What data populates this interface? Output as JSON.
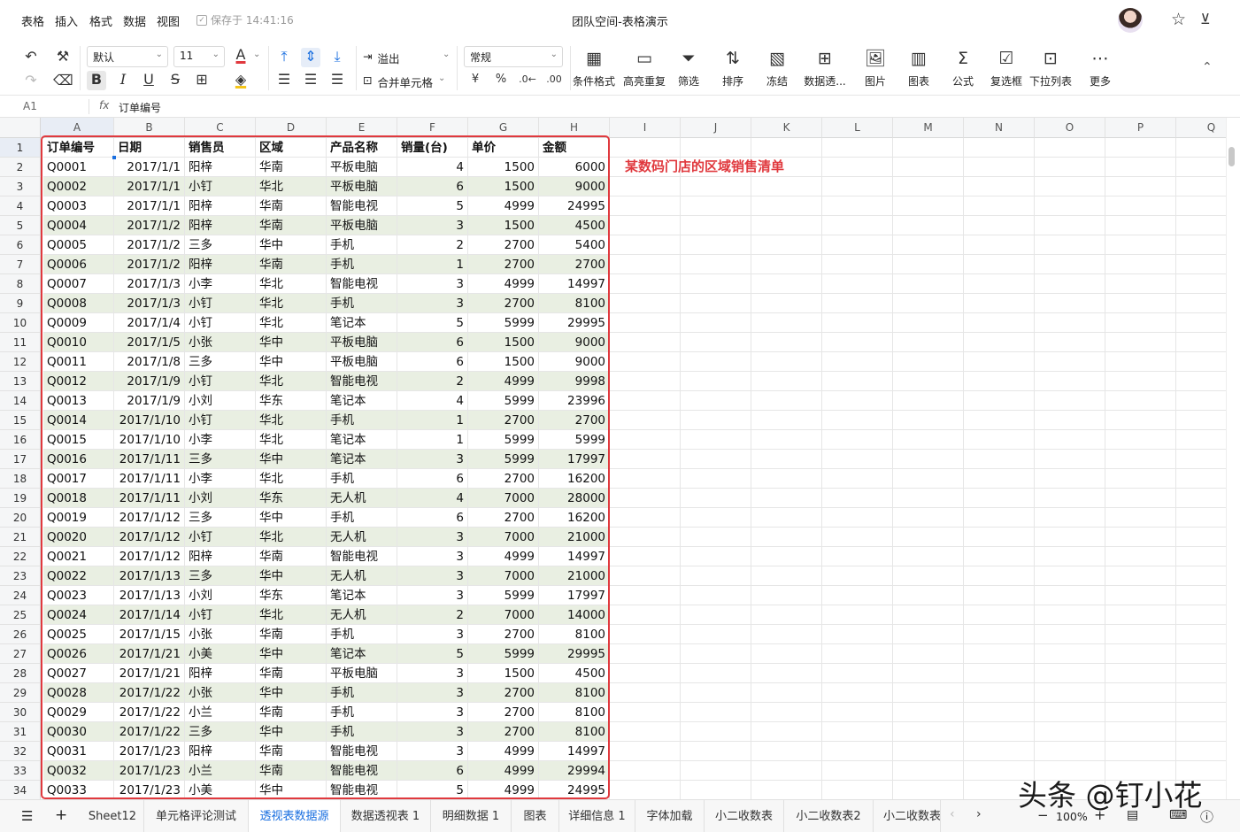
{
  "menu": {
    "items": [
      "表格",
      "插入",
      "格式",
      "数据",
      "视图"
    ],
    "save_status": "保存于 14:41:16",
    "doc_title": "团队空间-表格演示"
  },
  "toolbar": {
    "font_name": "默认",
    "font_size": "11",
    "overflow": "溢出",
    "merge": "合并单元格",
    "number_format": "常规",
    "currency": "¥",
    "percent": "%",
    "big_buttons": [
      {
        "label": "条件格式",
        "icon": "conditional-format-icon",
        "glyph": "▦"
      },
      {
        "label": "高亮重复",
        "icon": "highlight-duplicate-icon",
        "glyph": "▭"
      },
      {
        "label": "筛选",
        "icon": "filter-icon",
        "glyph": "⏷"
      },
      {
        "label": "排序",
        "icon": "sort-icon",
        "glyph": "⇅"
      },
      {
        "label": "冻结",
        "icon": "freeze-icon",
        "glyph": "▧"
      },
      {
        "label": "数据透...",
        "icon": "pivot-icon",
        "glyph": "⊞"
      },
      {
        "label": "图片",
        "icon": "image-icon",
        "glyph": "🖼"
      },
      {
        "label": "图表",
        "icon": "chart-icon",
        "glyph": "▥"
      },
      {
        "label": "公式",
        "icon": "formula-icon",
        "glyph": "Σ"
      },
      {
        "label": "复选框",
        "icon": "checkbox-icon",
        "glyph": "☑"
      },
      {
        "label": "下拉列表",
        "icon": "dropdown-list-icon",
        "glyph": "⊡"
      },
      {
        "label": "更多",
        "icon": "more-icon",
        "glyph": "⋯"
      }
    ]
  },
  "formula_bar": {
    "cell_ref": "A1",
    "fx": "fx",
    "content": "订单编号"
  },
  "sheet": {
    "columns": [
      "A",
      "B",
      "C",
      "D",
      "E",
      "F",
      "G",
      "H",
      "I",
      "J",
      "K",
      "L",
      "M",
      "N",
      "O",
      "P",
      "Q"
    ],
    "headers": [
      "订单编号",
      "日期",
      "销售员",
      "区域",
      "产品名称",
      "销量(台)",
      "单价",
      "金额"
    ],
    "rows": [
      [
        "Q0001",
        "2017/1/1",
        "阳梓",
        "华南",
        "平板电脑",
        "4",
        "1500",
        "6000"
      ],
      [
        "Q0002",
        "2017/1/1",
        "小钉",
        "华北",
        "平板电脑",
        "6",
        "1500",
        "9000"
      ],
      [
        "Q0003",
        "2017/1/1",
        "阳梓",
        "华南",
        "智能电视",
        "5",
        "4999",
        "24995"
      ],
      [
        "Q0004",
        "2017/1/2",
        "阳梓",
        "华南",
        "平板电脑",
        "3",
        "1500",
        "4500"
      ],
      [
        "Q0005",
        "2017/1/2",
        "三多",
        "华中",
        "手机",
        "2",
        "2700",
        "5400"
      ],
      [
        "Q0006",
        "2017/1/2",
        "阳梓",
        "华南",
        "手机",
        "1",
        "2700",
        "2700"
      ],
      [
        "Q0007",
        "2017/1/3",
        "小李",
        "华北",
        "智能电视",
        "3",
        "4999",
        "14997"
      ],
      [
        "Q0008",
        "2017/1/3",
        "小钉",
        "华北",
        "手机",
        "3",
        "2700",
        "8100"
      ],
      [
        "Q0009",
        "2017/1/4",
        "小钉",
        "华北",
        "笔记本",
        "5",
        "5999",
        "29995"
      ],
      [
        "Q0010",
        "2017/1/5",
        "小张",
        "华中",
        "平板电脑",
        "6",
        "1500",
        "9000"
      ],
      [
        "Q0011",
        "2017/1/8",
        "三多",
        "华中",
        "平板电脑",
        "6",
        "1500",
        "9000"
      ],
      [
        "Q0012",
        "2017/1/9",
        "小钉",
        "华北",
        "智能电视",
        "2",
        "4999",
        "9998"
      ],
      [
        "Q0013",
        "2017/1/9",
        "小刘",
        "华东",
        "笔记本",
        "4",
        "5999",
        "23996"
      ],
      [
        "Q0014",
        "2017/1/10",
        "小钉",
        "华北",
        "手机",
        "1",
        "2700",
        "2700"
      ],
      [
        "Q0015",
        "2017/1/10",
        "小李",
        "华北",
        "笔记本",
        "1",
        "5999",
        "5999"
      ],
      [
        "Q0016",
        "2017/1/11",
        "三多",
        "华中",
        "笔记本",
        "3",
        "5999",
        "17997"
      ],
      [
        "Q0017",
        "2017/1/11",
        "小李",
        "华北",
        "手机",
        "6",
        "2700",
        "16200"
      ],
      [
        "Q0018",
        "2017/1/11",
        "小刘",
        "华东",
        "无人机",
        "4",
        "7000",
        "28000"
      ],
      [
        "Q0019",
        "2017/1/12",
        "三多",
        "华中",
        "手机",
        "6",
        "2700",
        "16200"
      ],
      [
        "Q0020",
        "2017/1/12",
        "小钉",
        "华北",
        "无人机",
        "3",
        "7000",
        "21000"
      ],
      [
        "Q0021",
        "2017/1/12",
        "阳梓",
        "华南",
        "智能电视",
        "3",
        "4999",
        "14997"
      ],
      [
        "Q0022",
        "2017/1/13",
        "三多",
        "华中",
        "无人机",
        "3",
        "7000",
        "21000"
      ],
      [
        "Q0023",
        "2017/1/13",
        "小刘",
        "华东",
        "笔记本",
        "3",
        "5999",
        "17997"
      ],
      [
        "Q0024",
        "2017/1/14",
        "小钉",
        "华北",
        "无人机",
        "2",
        "7000",
        "14000"
      ],
      [
        "Q0025",
        "2017/1/15",
        "小张",
        "华南",
        "手机",
        "3",
        "2700",
        "8100"
      ],
      [
        "Q0026",
        "2017/1/21",
        "小美",
        "华中",
        "笔记本",
        "5",
        "5999",
        "29995"
      ],
      [
        "Q0027",
        "2017/1/21",
        "阳梓",
        "华南",
        "平板电脑",
        "3",
        "1500",
        "4500"
      ],
      [
        "Q0028",
        "2017/1/22",
        "小张",
        "华中",
        "手机",
        "3",
        "2700",
        "8100"
      ],
      [
        "Q0029",
        "2017/1/22",
        "小兰",
        "华南",
        "手机",
        "3",
        "2700",
        "8100"
      ],
      [
        "Q0030",
        "2017/1/22",
        "三多",
        "华中",
        "手机",
        "3",
        "2700",
        "8100"
      ],
      [
        "Q0031",
        "2017/1/23",
        "阳梓",
        "华南",
        "智能电视",
        "3",
        "4999",
        "14997"
      ],
      [
        "Q0032",
        "2017/1/23",
        "小兰",
        "华南",
        "智能电视",
        "6",
        "4999",
        "29994"
      ],
      [
        "Q0033",
        "2017/1/23",
        "小美",
        "华中",
        "智能电视",
        "5",
        "4999",
        "24995"
      ]
    ],
    "note": "某数码门店的区域销售清单"
  },
  "tabs": {
    "items": [
      "Sheet12",
      "单元格评论测试",
      "透视表数据源",
      "数据透视表 1",
      "明细数据 1",
      "图表",
      "详细信息 1",
      "字体加载",
      "小二收数表",
      "小二收数表2",
      "小二收数表"
    ],
    "active_index": 2,
    "zoom": "100%"
  },
  "watermark": "头条 @钉小花",
  "colors": {
    "accent": "#1a6fe0",
    "highlight_red": "#e0393e",
    "row_shade": "#e9efe2"
  }
}
